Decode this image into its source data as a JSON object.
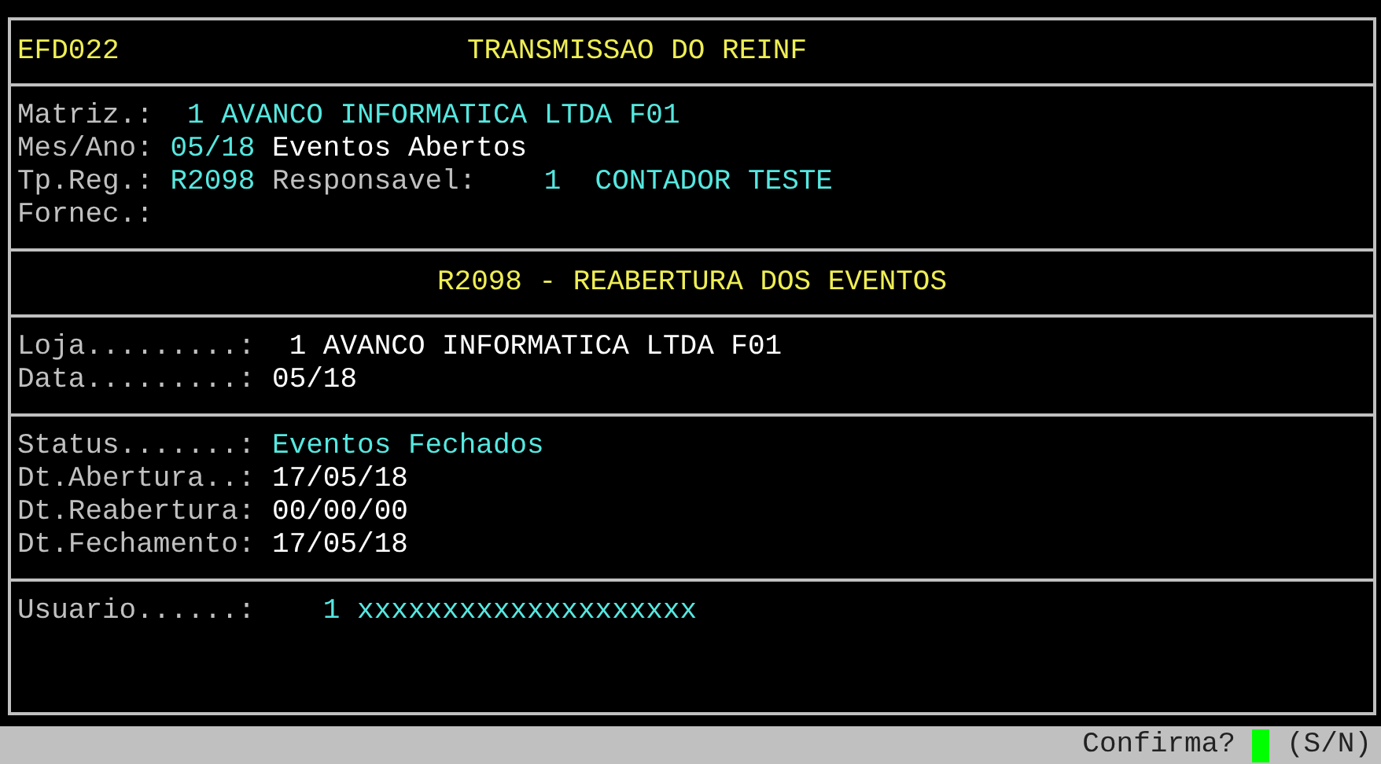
{
  "header": {
    "code": "EFD022",
    "title": "TRANSMISSAO DO REINF"
  },
  "sections": [
    {
      "kind": "lines",
      "lines": [
        [
          {
            "text": "Matriz.:",
            "color": "#c0c0c0"
          },
          {
            "text": " 1 AVANCO INFORMATICA LTDA F01",
            "color": "#55e8e0"
          }
        ],
        [
          {
            "text": "Mes/Ano:",
            "color": "#c0c0c0"
          },
          {
            "text": "05/18",
            "color": "#55e8e0"
          },
          {
            "text": "Eventos Abertos",
            "color": "#ffffff"
          }
        ],
        [
          {
            "text": "Tp.Reg.:",
            "color": "#c0c0c0"
          },
          {
            "text": "R2098",
            "color": "#55e8e0"
          },
          {
            "text": "Responsavel:",
            "color": "#c0c0c0"
          },
          {
            "text": "   1  CONTADOR TESTE",
            "color": "#55e8e0"
          }
        ],
        [
          {
            "text": "Fornec.:",
            "color": "#c0c0c0"
          }
        ]
      ]
    },
    {
      "kind": "title",
      "text": "R2098 - REABERTURA DOS EVENTOS"
    },
    {
      "kind": "lines",
      "lines": [
        [
          {
            "text": "Loja.........:",
            "color": "#c0c0c0"
          },
          {
            "text": " 1 AVANCO INFORMATICA LTDA F01",
            "color": "#ffffff"
          }
        ],
        [
          {
            "text": "Data.........:",
            "color": "#c0c0c0"
          },
          {
            "text": "05/18",
            "color": "#ffffff"
          }
        ]
      ]
    },
    {
      "kind": "lines",
      "lines": [
        [
          {
            "text": "Status.......:",
            "color": "#c0c0c0"
          },
          {
            "text": "Eventos Fechados",
            "color": "#55e8e0"
          }
        ],
        [
          {
            "text": "Dt.Abertura..:",
            "color": "#c0c0c0"
          },
          {
            "text": "17/05/18",
            "color": "#ffffff"
          }
        ],
        [
          {
            "text": "Dt.Reabertura:",
            "color": "#c0c0c0"
          },
          {
            "text": "00/00/00",
            "color": "#ffffff"
          }
        ],
        [
          {
            "text": "Dt.Fechamento:",
            "color": "#c0c0c0"
          },
          {
            "text": "17/05/18",
            "color": "#ffffff"
          }
        ]
      ]
    },
    {
      "kind": "lines",
      "lines": [
        [
          {
            "text": "Usuario......:",
            "color": "#c0c0c0"
          },
          {
            "text": "   1 xxxxxxxxxxxxxxxxxxxx",
            "color": "#55e8e0"
          }
        ]
      ]
    }
  ],
  "status_bar": {
    "prompt": "Confirma?",
    "options": "(S/N)"
  }
}
